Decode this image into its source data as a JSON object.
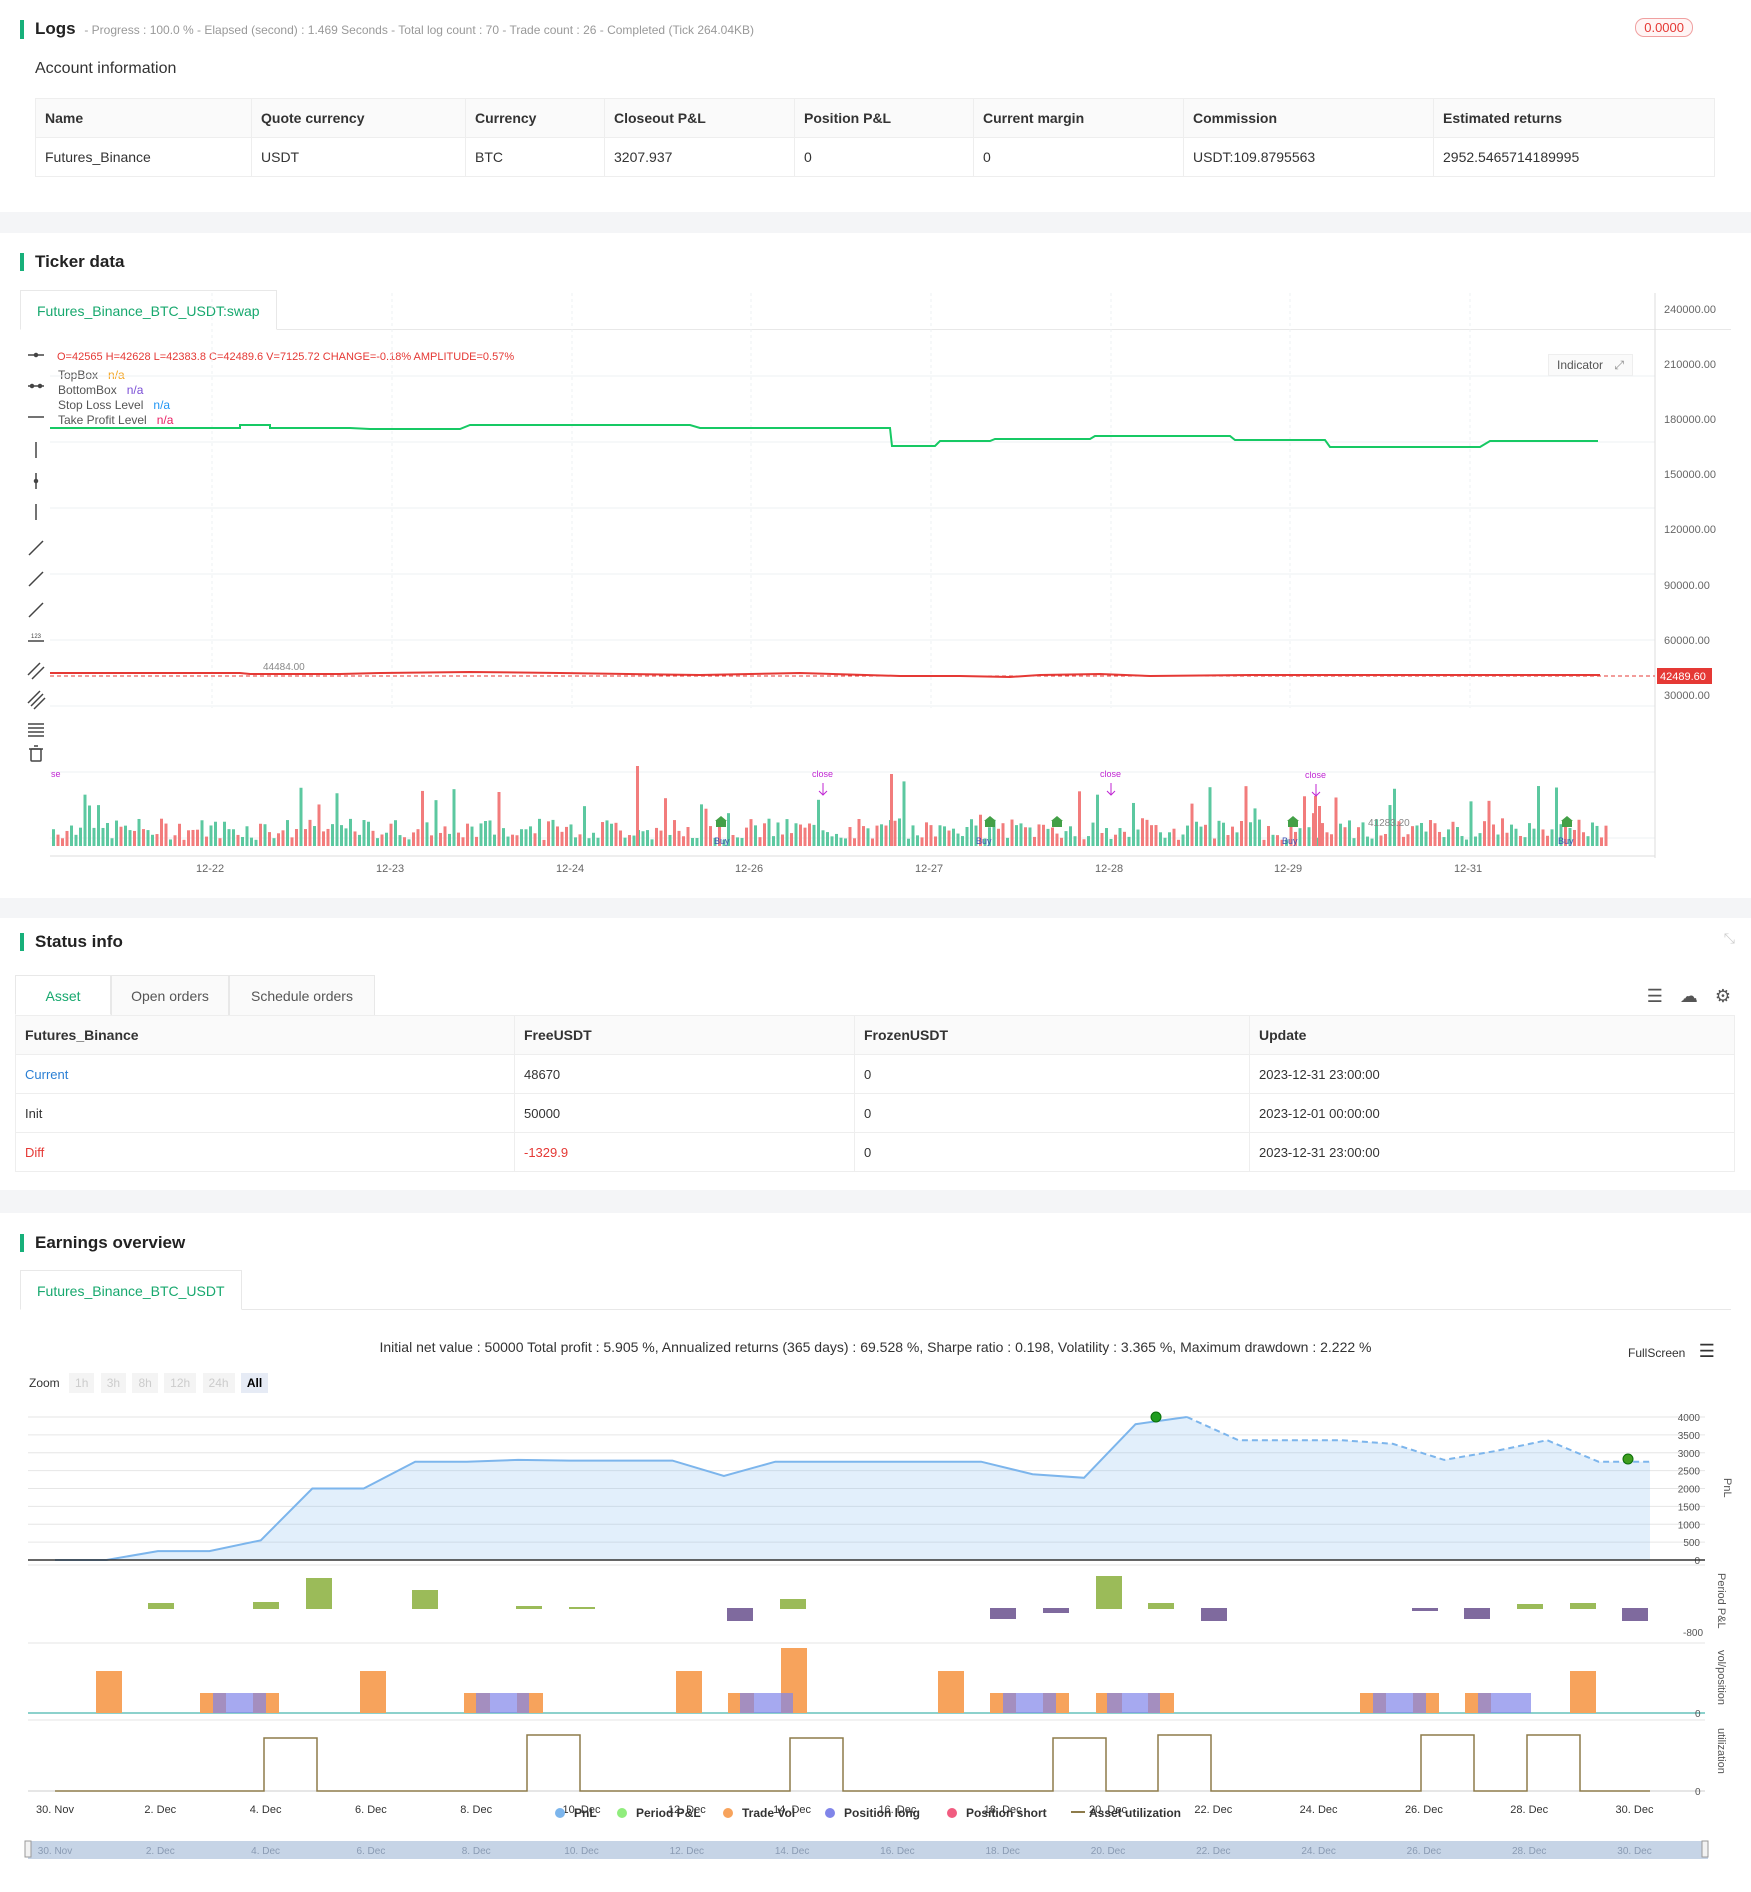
{
  "logs": {
    "title": "Logs",
    "subtitle": "- Progress : 100.0 % - Elapsed (second) : 1.469  Seconds - Total log count : 70 - Trade count : 26 - Completed (Tick 264.04KB)",
    "badge": "0.0000",
    "account_title": "Account information",
    "columns": [
      "Name",
      "Quote currency",
      "Currency",
      "Closeout P&L",
      "Position P&L",
      "Current margin",
      "Commission",
      "Estimated returns"
    ],
    "row": [
      "Futures_Binance",
      "USDT",
      "BTC",
      "3207.937",
      "0",
      "0",
      "USDT:109.8795563",
      "2952.5465714189995"
    ]
  },
  "ticker": {
    "title": "Ticker data",
    "tab": "Futures_Binance_BTC_USDT:swap",
    "ohlc": "O=42565 H=42628 L=42383.8 C=42489.6 V=7125.72 CHANGE=-0.18% AMPLITUDE=0.57%",
    "legend": [
      {
        "name": "TopBox",
        "value": "n/a",
        "color": "#f5a623"
      },
      {
        "name": "BottomBox",
        "value": "n/a",
        "color": "#7b4fd6"
      },
      {
        "name": "Stop Loss Level",
        "value": "n/a",
        "color": "#2196f3"
      },
      {
        "name": "Take Profit Level",
        "value": "n/a",
        "color": "#e91e63"
      }
    ],
    "indicator_btn": "Indicator",
    "y_ticks": [
      "240000.00",
      "210000.00",
      "180000.00",
      "150000.00",
      "120000.00",
      "90000.00",
      "60000.00",
      "30000.00"
    ],
    "x_ticks": [
      "12-22",
      "12-23",
      "12-24",
      "12-26",
      "12-27",
      "12-28",
      "12-29",
      "12-31"
    ],
    "last_price": "42489.60",
    "high_label": "44484.00",
    "low_label": "41283.20",
    "close_label": "close",
    "close_label_left": "se",
    "buy_label": "Buy"
  },
  "status": {
    "title": "Status info",
    "tabs": [
      "Asset",
      "Open orders",
      "Schedule orders"
    ],
    "columns": [
      "Futures_Binance",
      "FreeUSDT",
      "FrozenUSDT",
      "Update"
    ],
    "rows": [
      [
        "Current",
        "48670",
        "0",
        "2023-12-31 23:00:00"
      ],
      [
        "Init",
        "50000",
        "0",
        "2023-12-01 00:00:00"
      ],
      [
        "Diff",
        "-1329.9",
        "0",
        "2023-12-31 23:00:00"
      ]
    ]
  },
  "earnings": {
    "title": "Earnings overview",
    "tab": "Futures_Binance_BTC_USDT",
    "summary": "Initial net value : 50000 Total profit : 5.905 %, Annualized returns (365 days) : 69.528 %, Sharpe ratio : 0.198, Volatility : 3.365 %, Maximum drawdown : 2.222 %",
    "fullscreen": "FullScreen",
    "zoom_label": "Zoom",
    "zoom_options": [
      "1h",
      "3h",
      "8h",
      "12h",
      "24h",
      "All"
    ],
    "pnl_ticks": [
      "4000",
      "3500",
      "3000",
      "2500",
      "2000",
      "1500",
      "1000",
      "500",
      "0"
    ],
    "period_tick": "-800",
    "vol_tick": "0",
    "util_tick": "0",
    "axis_names": [
      "PnL",
      "Period P&L",
      "vol/position",
      "utilization"
    ],
    "x_ticks": [
      "30. Nov",
      "2. Dec",
      "4. Dec",
      "6. Dec",
      "8. Dec",
      "10. Dec",
      "12. Dec",
      "14. Dec",
      "16. Dec",
      "18. Dec",
      "20. Dec",
      "22. Dec",
      "24. Dec",
      "26. Dec",
      "28. Dec",
      "30. Dec"
    ],
    "legend": [
      {
        "name": "PnL",
        "color": "#7cb5ec"
      },
      {
        "name": "Period P&L",
        "color": "#90ed7d"
      },
      {
        "name": "Trade Vol",
        "color": "#f7a35c"
      },
      {
        "name": "Position long",
        "color": "#8085e9"
      },
      {
        "name": "Position short",
        "color": "#f15c80"
      },
      {
        "name": "Asset utilization",
        "color": "#8d7b4a"
      }
    ]
  },
  "chart_data": [
    {
      "type": "line",
      "title": "",
      "x": [
        "30. Nov",
        "1. Dec",
        "2. Dec",
        "3. Dec",
        "4. Dec",
        "5. Dec",
        "6. Dec",
        "7. Dec",
        "8. Dec",
        "9. Dec",
        "10. Dec",
        "11. Dec",
        "12. Dec",
        "13. Dec",
        "14. Dec",
        "15. Dec",
        "16. Dec",
        "17. Dec",
        "18. Dec",
        "19. Dec",
        "20. Dec",
        "21. Dec",
        "22. Dec",
        "23. Dec",
        "24. Dec",
        "25. Dec",
        "26. Dec",
        "27. Dec",
        "28. Dec",
        "29. Dec",
        "30. Dec",
        "31. Dec"
      ],
      "series": [
        {
          "name": "PnL",
          "values": [
            0,
            0,
            250,
            250,
            550,
            2000,
            2000,
            2750,
            2750,
            2800,
            2780,
            2780,
            2780,
            2350,
            2750,
            2750,
            2750,
            2750,
            2750,
            2400,
            2300,
            3800,
            4000,
            3350,
            3350,
            3350,
            3250,
            2800,
            3050,
            3350,
            2750,
            2750
          ]
        }
      ],
      "ylim": [
        0,
        4000
      ]
    }
  ]
}
